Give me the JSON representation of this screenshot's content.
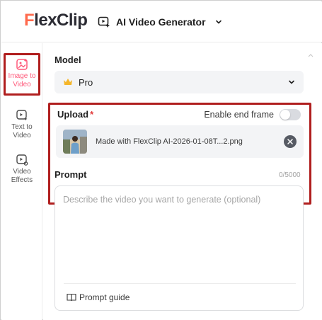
{
  "header": {
    "logo_first_letter": "F",
    "logo_rest": "lexClip",
    "tool_label": "AI Video Generator"
  },
  "sidebar": {
    "items": [
      {
        "label": "Image to Video",
        "icon": "image-to-video-icon",
        "active": true
      },
      {
        "label": "Text to Video",
        "icon": "text-to-video-icon",
        "active": false
      },
      {
        "label": "Video Effects",
        "icon": "video-effects-icon",
        "active": false
      }
    ]
  },
  "model": {
    "label": "Model",
    "value": "Pro",
    "icon": "crown-icon"
  },
  "upload": {
    "label": "Upload",
    "required_mark": "*",
    "end_frame_label": "Enable end frame",
    "end_frame_enabled": false,
    "file_name": "Made with FlexClip AI-2026-01-08T...2.png"
  },
  "prompt": {
    "label": "Prompt",
    "counter": "0/5000",
    "value": "",
    "placeholder": "Describe the video you want to generate (optional)",
    "guide_label": "Prompt guide"
  },
  "colors": {
    "brand_logo_accent": "#ff6a4d",
    "active_sidebar_text": "#ff5a7a",
    "highlight_border": "#b01e1e",
    "required_star": "#e23a3a"
  }
}
